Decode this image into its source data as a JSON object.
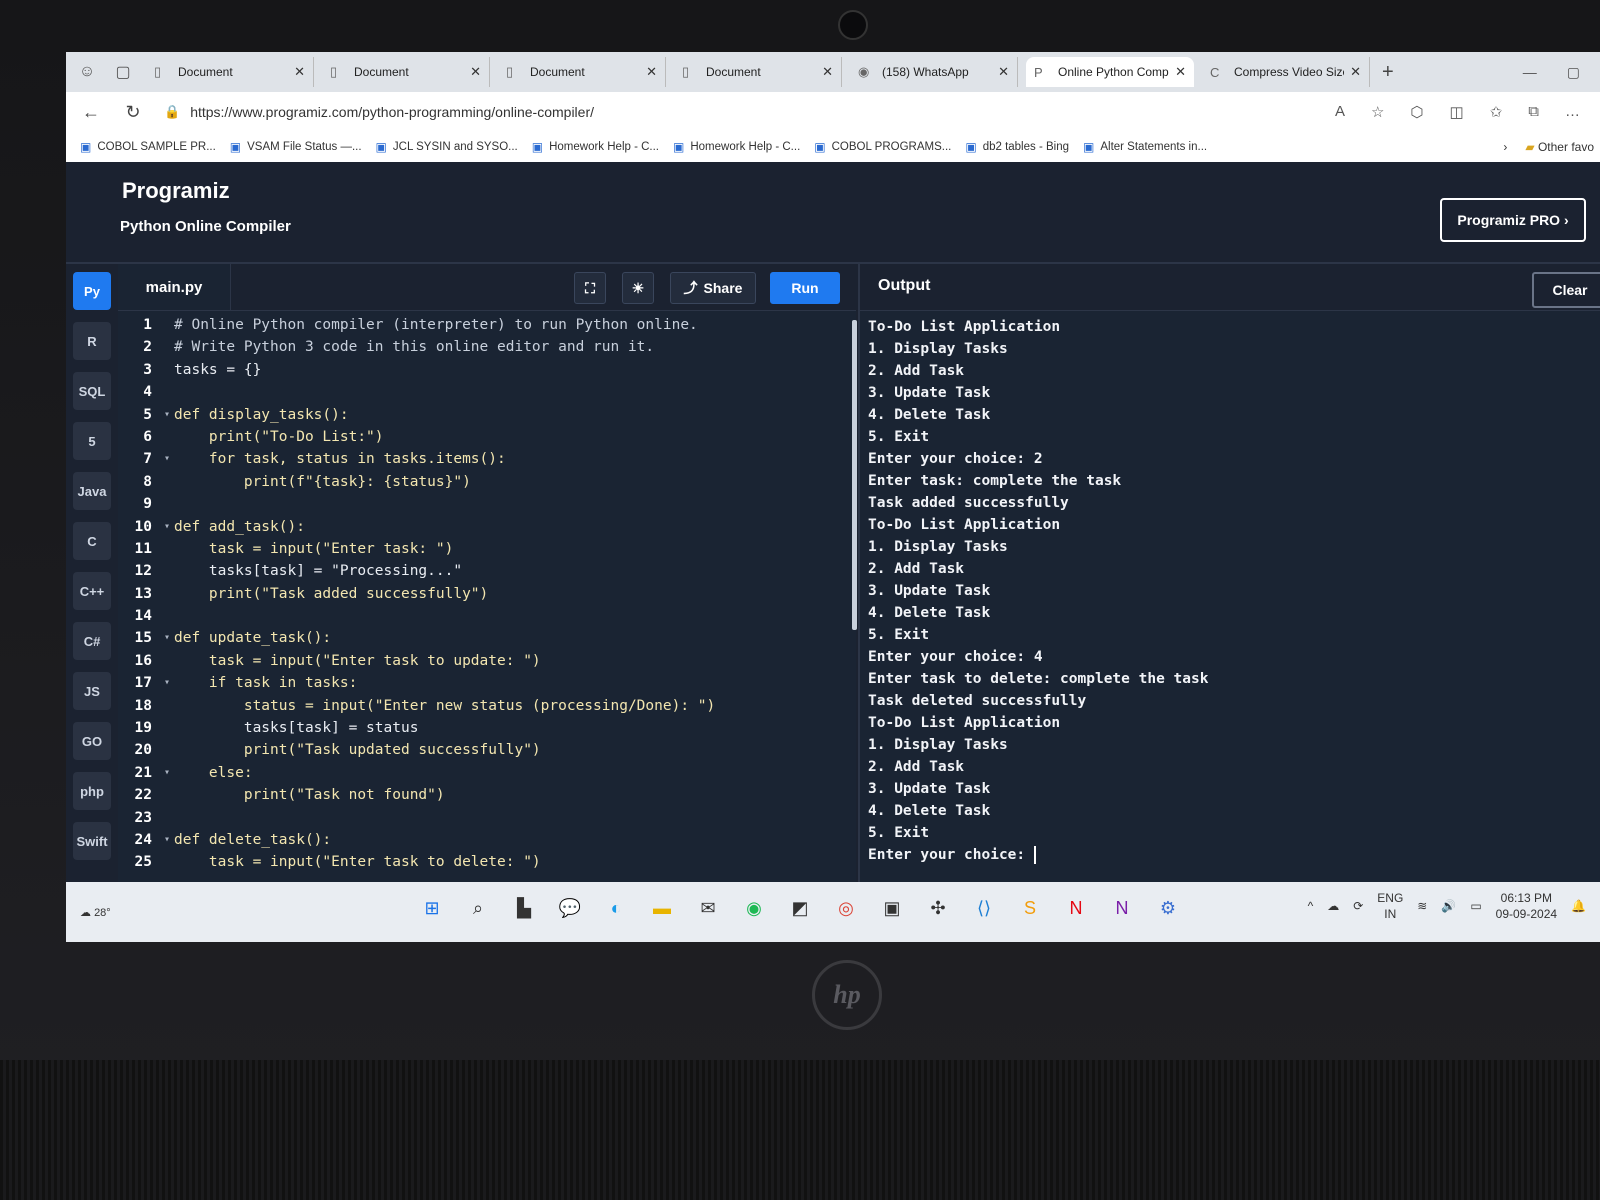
{
  "browser": {
    "tabs": [
      {
        "label": "Document",
        "icon": "page-icon",
        "active": false
      },
      {
        "label": "Document",
        "icon": "page-icon",
        "active": false
      },
      {
        "label": "Document",
        "icon": "page-icon",
        "active": false
      },
      {
        "label": "Document",
        "icon": "page-icon",
        "active": false
      },
      {
        "label": "(158) WhatsApp",
        "icon": "whatsapp-icon",
        "active": false
      },
      {
        "label": "Online Python Comp",
        "icon": "programiz-icon",
        "active": true
      },
      {
        "label": "Compress Video Size",
        "icon": "compress-icon",
        "active": false
      }
    ],
    "url": "https://www.programiz.com/python-programming/online-compiler/",
    "bookmarks": [
      "COBOL SAMPLE PR...",
      "VSAM File Status —...",
      "JCL SYSIN and SYSO...",
      "Homework Help - C...",
      "Homework Help - C...",
      "COBOL PROGRAMS...",
      "db2 tables - Bing",
      "Alter Statements in..."
    ],
    "other_favorites": "Other favo"
  },
  "app": {
    "logo": "Programiz",
    "subtitle": "Python Online Compiler",
    "pro_button": "Programiz PRO ›",
    "languages": [
      "Py",
      "R",
      "SQL",
      "5",
      "Java",
      "C",
      "C++",
      "C#",
      "JS",
      "GO",
      "php",
      "Swift"
    ],
    "file_tab": "main.py",
    "share_label": "Share",
    "run_label": "Run",
    "output_title": "Output",
    "clear_label": "Clear"
  },
  "code_lines": [
    {
      "n": "1",
      "fold": "",
      "text": "# Online Python compiler (interpreter) to run Python online."
    },
    {
      "n": "2",
      "fold": "",
      "text": "# Write Python 3 code in this online editor and run it."
    },
    {
      "n": "3",
      "fold": "",
      "text": "tasks = {}"
    },
    {
      "n": "4",
      "fold": "",
      "text": ""
    },
    {
      "n": "5",
      "fold": "▾",
      "text": "def display_tasks():"
    },
    {
      "n": "6",
      "fold": "",
      "text": "    print(\"To-Do List:\")"
    },
    {
      "n": "7",
      "fold": "▾",
      "text": "    for task, status in tasks.items():"
    },
    {
      "n": "8",
      "fold": "",
      "text": "        print(f\"{task}: {status}\")"
    },
    {
      "n": "9",
      "fold": "",
      "text": ""
    },
    {
      "n": "10",
      "fold": "▾",
      "text": "def add_task():"
    },
    {
      "n": "11",
      "fold": "",
      "text": "    task = input(\"Enter task: \")"
    },
    {
      "n": "12",
      "fold": "",
      "text": "    tasks[task] = \"Processing...\""
    },
    {
      "n": "13",
      "fold": "",
      "text": "    print(\"Task added successfully\")"
    },
    {
      "n": "14",
      "fold": "",
      "text": ""
    },
    {
      "n": "15",
      "fold": "▾",
      "text": "def update_task():"
    },
    {
      "n": "16",
      "fold": "",
      "text": "    task = input(\"Enter task to update: \")"
    },
    {
      "n": "17",
      "fold": "▾",
      "text": "    if task in tasks:"
    },
    {
      "n": "18",
      "fold": "",
      "text": "        status = input(\"Enter new status (processing/Done): \")"
    },
    {
      "n": "19",
      "fold": "",
      "text": "        tasks[task] = status"
    },
    {
      "n": "20",
      "fold": "",
      "text": "        print(\"Task updated successfully\")"
    },
    {
      "n": "21",
      "fold": "▾",
      "text": "    else:"
    },
    {
      "n": "22",
      "fold": "",
      "text": "        print(\"Task not found\")"
    },
    {
      "n": "23",
      "fold": "",
      "text": ""
    },
    {
      "n": "24",
      "fold": "▾",
      "text": "def delete_task():"
    },
    {
      "n": "25",
      "fold": "",
      "text": "    task = input(\"Enter task to delete: \")"
    }
  ],
  "output_lines": [
    "To-Do List Application",
    "1. Display Tasks",
    "2. Add Task",
    "3. Update Task",
    "4. Delete Task",
    "5. Exit",
    "Enter your choice: 2",
    "Enter task: complete the task",
    "Task added successfully",
    "To-Do List Application",
    "1. Display Tasks",
    "2. Add Task",
    "3. Update Task",
    "4. Delete Task",
    "5. Exit",
    "Enter your choice: 4",
    "Enter task to delete: complete the task",
    "Task deleted successfully",
    "To-Do List Application",
    "1. Display Tasks",
    "2. Add Task",
    "3. Update Task",
    "4. Delete Task",
    "5. Exit",
    "Enter your choice: "
  ],
  "taskbar": {
    "weather": "28°",
    "apps": [
      "windows-start-icon",
      "search-icon",
      "task-view-icon",
      "chat-icon",
      "edge-icon",
      "file-explorer-icon",
      "mail-icon",
      "spotify-icon",
      "sticky-notes-icon",
      "chrome-icon",
      "store-icon",
      "slack-icon",
      "vscode-icon",
      "sublime-icon",
      "netflix-icon",
      "onenote-icon",
      "settings-icon"
    ],
    "lang_top": "ENG",
    "lang_bottom": "IN",
    "time": "06:13 PM",
    "date": "09-09-2024"
  },
  "colors": {
    "run": "#1f7af0",
    "editor_bg": "#1a2433",
    "keyword": "#f3d27a"
  }
}
